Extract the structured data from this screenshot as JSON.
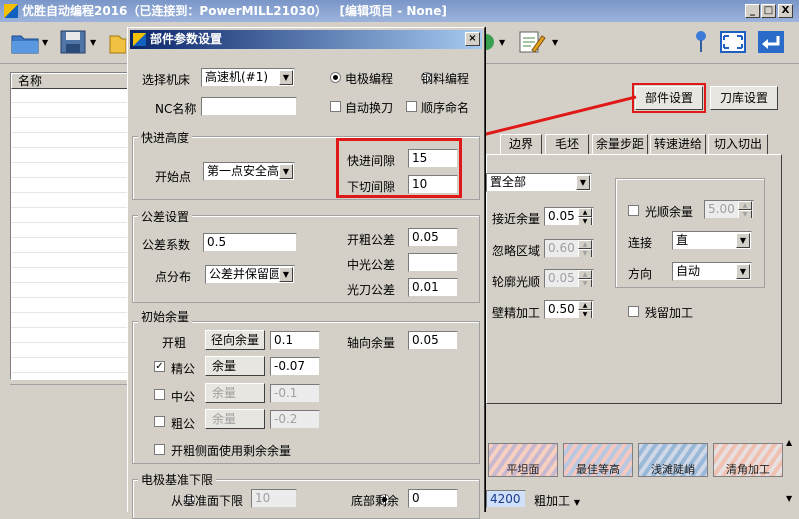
{
  "main_window": {
    "title": "优胜自动编程2016（已连接到：PowerMILL21030）   [编辑项目 - None]",
    "controls": [
      "_",
      "□",
      "X"
    ],
    "list_header": "名称",
    "right_buttons": {
      "part_settings": "部件设置",
      "tool_library": "刀库设置"
    },
    "tabs": [
      "边界",
      "毛坯",
      "余量步距",
      "转速进给",
      "切入切出"
    ],
    "bg_panel": {
      "set_all": "置全部",
      "approach_allowance_label": "接近余量",
      "approach_allowance": "0.05",
      "ignore_area_label": "忽略区域",
      "ignore_area": "0.60",
      "contour_smooth_label": "轮廓光顺",
      "contour_smooth": "0.05",
      "wall_finish_label": "壁精加工",
      "wall_finish": "0.50",
      "smooth_allowance_label": "光顺余量",
      "smooth_allowance": "5.00",
      "connect_label": "连接",
      "connect_value": "直",
      "direction_label": "方向",
      "direction_value": "自动",
      "residual_label": "残留加工"
    },
    "thumbnails": [
      "平坦面",
      "最佳等高",
      "浅滩陡峭",
      "清角加工"
    ],
    "status": {
      "value": "4200",
      "mode": "粗加工"
    }
  },
  "dialog": {
    "title": "部件参数设置",
    "close": "×",
    "machine_label": "选择机床",
    "machine_value": "高速机(#1)",
    "electrode_label": "电极编程",
    "steel_label": "钢料编程",
    "nc_label": "NC名称",
    "nc_value": "",
    "auto_tool_change": "自动换刀",
    "sequential_naming": "顺序命名",
    "rapid": {
      "title": "快进高度",
      "start_label": "开始点",
      "start_value": "第一点安全高度",
      "rapid_gap_label": "快进间隙",
      "rapid_gap": "15",
      "plunge_gap_label": "下切间隙",
      "plunge_gap": "10"
    },
    "tolerance": {
      "title": "公差设置",
      "factor_label": "公差系数",
      "factor": "0.5",
      "rough_label": "开粗公差",
      "rough": "0.05",
      "distribution_label": "点分布",
      "distribution": "公差并保留圆弧",
      "semi_label": "中光公差",
      "semi": "",
      "finish_label": "光刀公差",
      "finish": "0.01"
    },
    "allowance": {
      "title": "初始余量",
      "rough_label": "开粗",
      "radial_btn": "径向余量",
      "rough_radial": "0.1",
      "axial_label": "轴向余量",
      "rough_axial": "0.05",
      "finish_label": "精公",
      "finish_btn": "余量",
      "finish_value": "-0.07",
      "mid_label": "中公",
      "mid_btn": "余量",
      "mid_value": "-0.1",
      "coarse_label": "粗公",
      "coarse_btn": "余量",
      "coarse_value": "-0.2",
      "side_remaining": "开粗侧面使用剩余余量"
    },
    "electrode_base": {
      "title": "电极基准下限",
      "from_base_label": "从基准面下限",
      "from_base_value": "10",
      "bottom_remaining_label": "底部剩余",
      "bottom_remaining_value": "0"
    }
  },
  "colors": {
    "highlight": "#e01818",
    "dialog_title_start": "#0a246a",
    "dialog_title_end": "#a6caf0"
  }
}
